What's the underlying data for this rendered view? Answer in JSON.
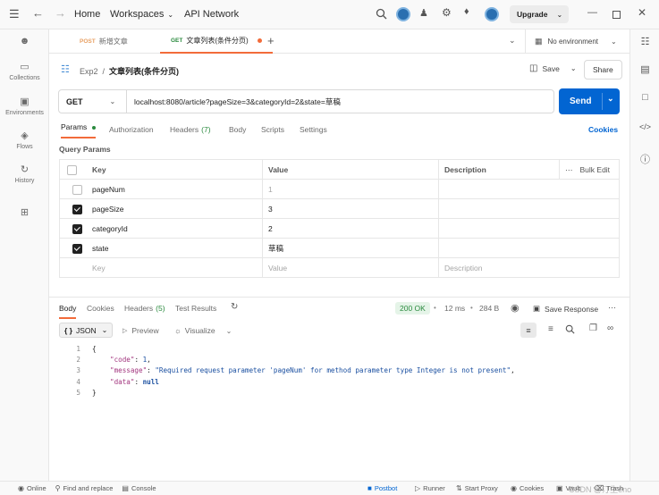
{
  "titlebar": {
    "home": "Home",
    "workspaces": "Workspaces",
    "api_network": "API Network",
    "upgrade": "Upgrade"
  },
  "rail": [
    {
      "label": "",
      "icon": "team-icon"
    },
    {
      "label": "Collections",
      "icon": "collections-icon"
    },
    {
      "label": "Environments",
      "icon": "environments-icon"
    },
    {
      "label": "Flows",
      "icon": "flows-icon"
    },
    {
      "label": "History",
      "icon": "history-icon"
    },
    {
      "label": "",
      "icon": "add-widgets-icon"
    }
  ],
  "tabs": [
    {
      "method": "POST",
      "label": "新增文章"
    },
    {
      "method": "GET",
      "label": "文章列表(条件分页)"
    }
  ],
  "environment": "No environment",
  "breadcrumb": {
    "collection": "Exp2",
    "sep": "/",
    "request": "文章列表(条件分页)"
  },
  "actions": {
    "save": "Save",
    "share": "Share"
  },
  "request": {
    "method": "GET",
    "url": "localhost:8080/article?pageSize=3&categoryId=2&state=草稿",
    "send": "Send"
  },
  "req_tabs": {
    "params": "Params",
    "authorization": "Authorization",
    "headers": "Headers",
    "headers_count": "(7)",
    "body": "Body",
    "scripts": "Scripts",
    "settings": "Settings",
    "cookies": "Cookies"
  },
  "query_params": {
    "title": "Query Params",
    "headers": {
      "key": "Key",
      "value": "Value",
      "description": "Description",
      "bulk": "Bulk Edit"
    },
    "rows": [
      {
        "key": "pageNum",
        "value": "1",
        "checked": false
      },
      {
        "key": "pageSize",
        "value": "3",
        "checked": true
      },
      {
        "key": "categoryId",
        "value": "2",
        "checked": true
      },
      {
        "key": "state",
        "value": "草稿",
        "checked": true
      }
    ],
    "placeholder": {
      "key": "Key",
      "value": "Value",
      "description": "Description"
    }
  },
  "response": {
    "tabs": {
      "body": "Body",
      "cookies": "Cookies",
      "headers": "Headers",
      "headers_count": "(5)",
      "test_results": "Test Results"
    },
    "status": "200 OK",
    "time": "12 ms",
    "size": "284 B",
    "save_response": "Save Response",
    "format": "JSON",
    "preview": "Preview",
    "visualize": "Visualize",
    "lines": [
      "1",
      "2",
      "3",
      "4",
      "5"
    ],
    "code": {
      "open": "{",
      "code_key": "\"code\"",
      "code_val": "1",
      "message_key": "\"message\"",
      "message_val": "\"Required request parameter 'pageNum' for method parameter type Integer is not present\"",
      "data_key": "\"data\"",
      "data_val": "null",
      "close": "}"
    }
  },
  "statusbar": {
    "online": "Online",
    "find_replace": "Find and replace",
    "console": "Console",
    "postbot": "Postbot",
    "runner": "Runner",
    "start_proxy": "Start Proxy",
    "cookies": "Cookies",
    "vault": "Vault",
    "trash": "Trash",
    "watermark": "CSDN @汀生eno"
  }
}
